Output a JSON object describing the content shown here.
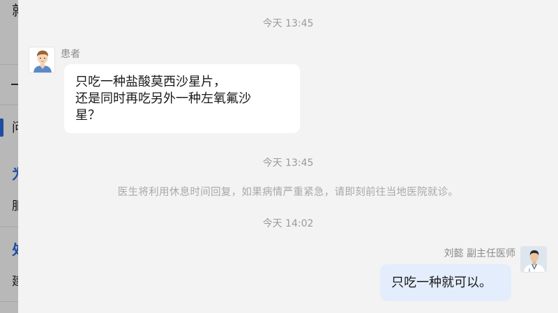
{
  "background_page": {
    "chars": [
      "就",
      "一",
      "问",
      "为",
      "服",
      "处",
      "建"
    ],
    "marker_color": "#2d6be0"
  },
  "chat": {
    "timestamps": [
      "今天 13:45",
      "今天 13:45",
      "今天 14:02"
    ],
    "patient": {
      "name": "患者",
      "avatar_icon": "patient-avatar-icon",
      "message_lines": [
        "只吃一种盐酸莫西沙星片，",
        "还是同时再吃另外一种左氧氟沙",
        "星？"
      ]
    },
    "notice": "医生将利用休息时间回复，如果病情严重紧急，请即刻前往当地医院就诊。",
    "doctor": {
      "name": "刘懿 副主任医师",
      "avatar_icon": "doctor-avatar-icon",
      "message": "只吃一种就可以。",
      "bubble_color": "#e3edfb"
    }
  }
}
